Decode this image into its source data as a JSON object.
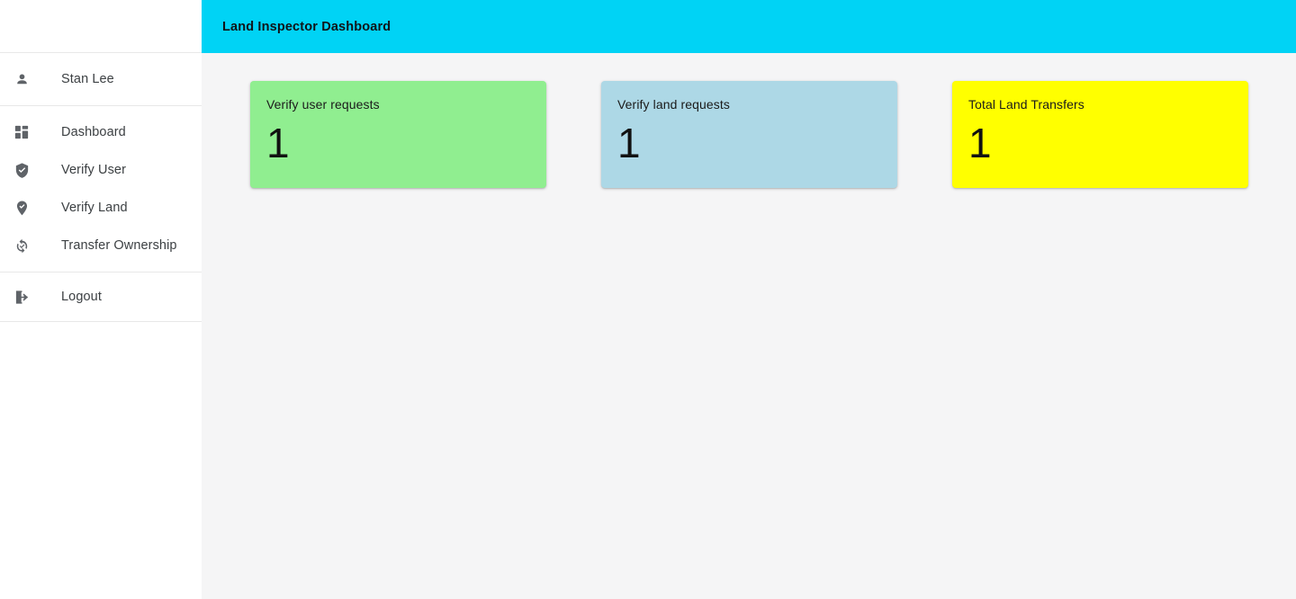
{
  "colors": {
    "header_bg": "#00d3f5",
    "page_bg": "#f5f5f6",
    "sidebar_bg": "#ffffff",
    "card_green": "#90ee90",
    "card_blue": "#add8e6",
    "card_yellow": "#ffff00",
    "icon": "#5f6368",
    "text": "#3c4043"
  },
  "sidebar": {
    "user": {
      "name": "Stan Lee",
      "icon": "person-icon"
    },
    "items": [
      {
        "label": "Dashboard",
        "icon": "dashboard-grid-icon"
      },
      {
        "label": "Verify User",
        "icon": "shield-check-icon"
      },
      {
        "label": "Verify Land",
        "icon": "map-pin-check-icon"
      },
      {
        "label": "Transfer Ownership",
        "icon": "sync-check-icon"
      }
    ],
    "logout": {
      "label": "Logout",
      "icon": "logout-icon"
    }
  },
  "header": {
    "title": "Land Inspector Dashboard"
  },
  "main": {
    "cards": [
      {
        "title": "Verify user requests",
        "value": "1",
        "color": "#90ee90"
      },
      {
        "title": "Verify land requests",
        "value": "1",
        "color": "#add8e6"
      },
      {
        "title": "Total Land Transfers",
        "value": "1",
        "color": "#ffff00"
      }
    ]
  }
}
